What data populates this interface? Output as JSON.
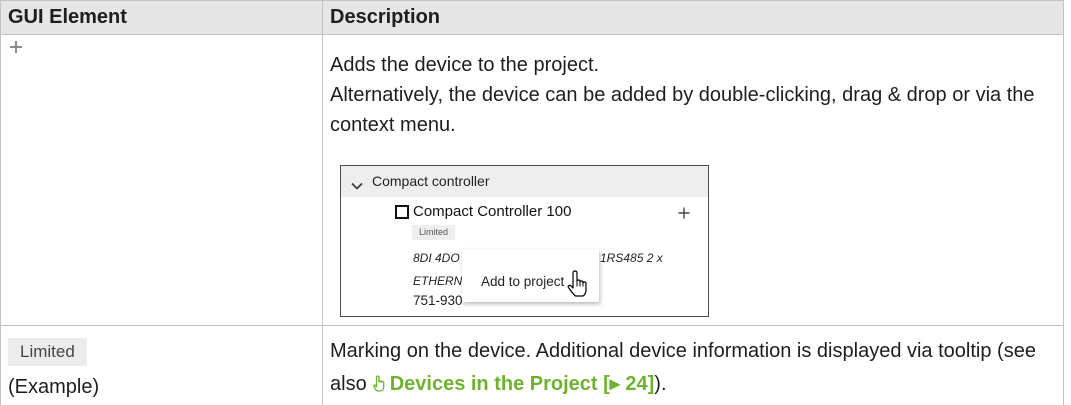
{
  "table": {
    "headers": {
      "gui_element": "GUI Element",
      "description": "Description"
    },
    "rows": [
      {
        "gui_element_icon": "plus-icon",
        "description": {
          "paragraph_1": "Adds the device to the project.",
          "paragraph_2": "Alternatively, the device can be added by double-clicking, drag & drop or via the context menu."
        },
        "example_screenshot": {
          "group_icon": "chevron-down-icon",
          "group_label": "Compact controller",
          "device_checkbox_icon": "checkbox-icon",
          "device_name": "Compact Controller 100",
          "add_icon": "plus-icon",
          "device_badge": "Limited",
          "detail_line_1_start": "8DI 4DO",
          "detail_line_1_end": "1RS485 2 x",
          "detail_line_2_start": "ETHERN",
          "order_number": "751-930",
          "context_menu": {
            "items": [
              "Add to project"
            ]
          },
          "cursor_icon": "hand-cursor-icon"
        }
      },
      {
        "gui_element": {
          "badge": "Limited",
          "caption": "(Example)"
        },
        "description": {
          "text_before_link": "Marking on the device. Additional device information is displayed via tooltip (see also",
          "link_icon": "link-pointer-icon",
          "link_text": "Devices in the Project [▸ 24]",
          "text_after_link": ")."
        }
      }
    ]
  },
  "colors": {
    "header_background": "#e6e6e6",
    "border": "#c3c3c3",
    "link": "#6db32f",
    "badge_background": "#ececec",
    "text": "#1e1e1e"
  }
}
